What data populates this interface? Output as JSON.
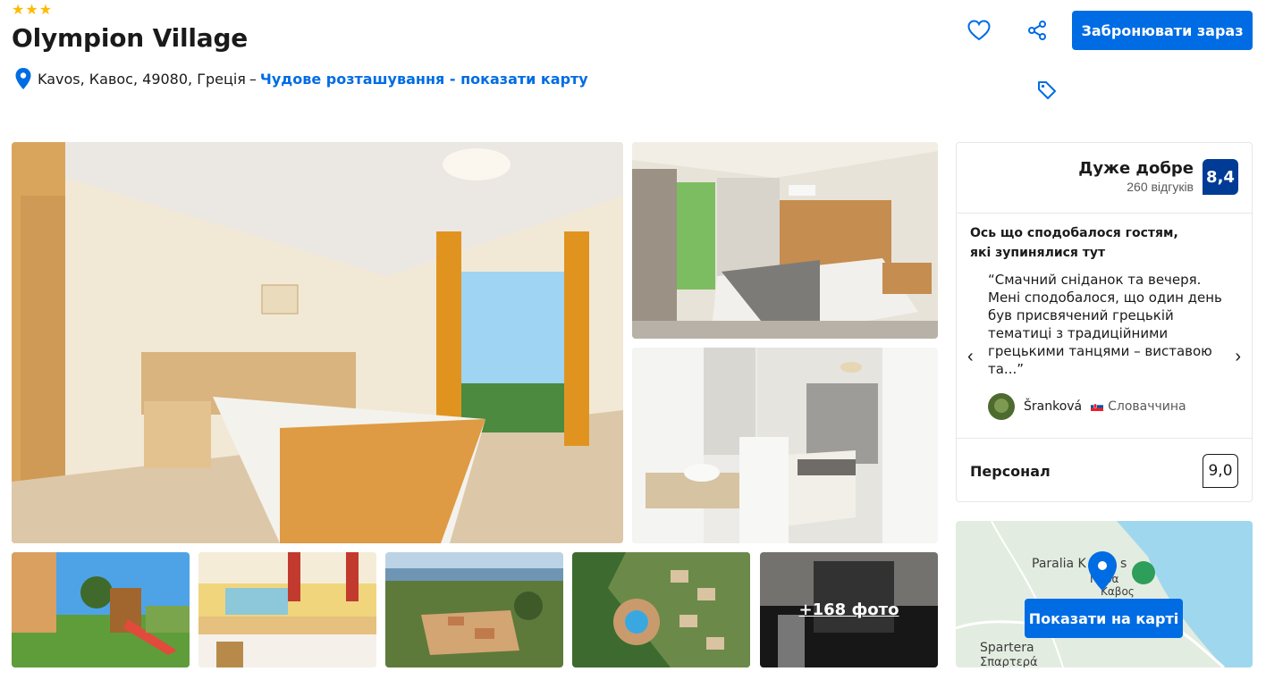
{
  "hotel": {
    "stars": 3,
    "name": "Olympion Village",
    "address": "Kavos, Кавос, 49080, Греція",
    "dash": "–",
    "map_link": "Чудове розташування - показати карту"
  },
  "actions": {
    "favorite_icon": "heart-icon",
    "share_icon": "share-icon",
    "price_tag_icon": "tag-icon",
    "book_label": "Забронювати зараз"
  },
  "gallery": {
    "more_photos_label": "+168 фото",
    "photos": [
      "main-room",
      "twin-room",
      "bathroom-room",
      "playground",
      "bar",
      "aerial-village",
      "aerial-pool",
      "kettle"
    ]
  },
  "review": {
    "rating_word": "Дуже добре",
    "review_count": "260 відгуків",
    "score": "8,4",
    "liked_heading": "Ось що сподобалося гостям, які зупинялися тут",
    "quote": "“Смачний сніданок та вечеря. Мені сподобалося, що один день був присвячений грецькій тематиці з традиційними грецькими танцями – виставою та...”",
    "reviewer_name": "Šranková",
    "reviewer_country": "Словаччина",
    "prev_icon": "chevron-left-icon",
    "next_icon": "chevron-right-icon",
    "staff_label": "Персонал",
    "staff_score": "9,0"
  },
  "map": {
    "button_label": "Показати на карті",
    "place_1": "Paralia K",
    "place_1_suffix": "s",
    "place_2": "Παρα",
    "place_3": "Καβος",
    "place_4": "Spartera",
    "place_5": "Σπαρτερά"
  },
  "colors": {
    "accent": "#006ce4",
    "score_badge": "#003b95",
    "star": "#febb02"
  }
}
